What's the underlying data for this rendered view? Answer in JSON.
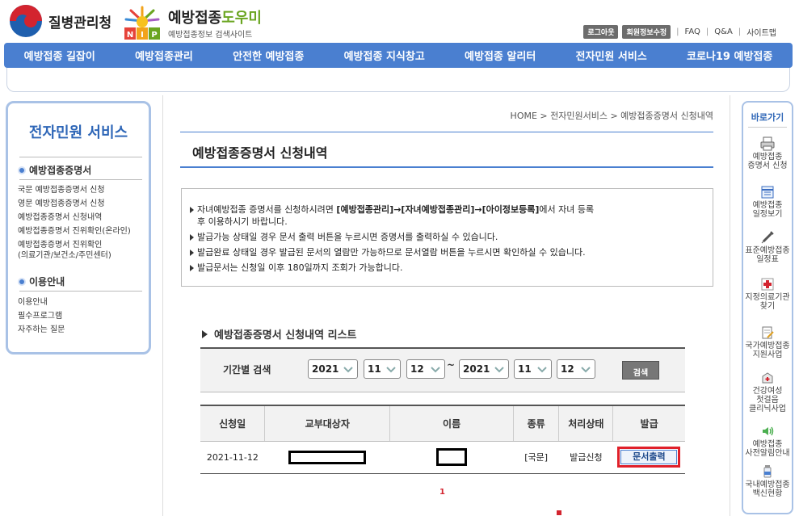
{
  "header": {
    "kdca_name": "질병관리청",
    "nip_title_a": "예방접종",
    "nip_title_b": "도우미",
    "nip_sub": "예방접종정보 검색사이트",
    "nip_mark": "NIP",
    "top_links": {
      "logout": "로그아웃",
      "member_edit": "회원정보수정",
      "faq": "FAQ",
      "qa": "Q&A",
      "sitemap": "사이트맵"
    }
  },
  "gnb": [
    "예방접종 길잡이",
    "예방접종관리",
    "안전한 예방접종",
    "예방접종 지식창고",
    "예방접종 알리터",
    "전자민원 서비스",
    "코로나19 예방접종"
  ],
  "sidebar": {
    "title": "전자민원 서비스",
    "section1": "예방접종증명서",
    "section1_items": [
      "국문 예방접종증명서 신청",
      "영문 예방접종증명서 신청",
      "예방접종증명서 신청내역",
      "예방접종증명서 진위확인(온라인)"
    ],
    "section1_item_multi_a": "예방접종증명서 진위확인",
    "section1_item_multi_b": "(의료기관/보건소/주민센터)",
    "section2": "이용안내",
    "section2_items": [
      "이용안내",
      "필수프로그램",
      "자주하는 질문"
    ]
  },
  "breadcrumb": "HOME > 전자민원서비스 > 예방접종증명서 신청내역",
  "page_title": "예방접종증명서 신청내역",
  "notice": {
    "line1_a": "자녀예방접종 증명서를 신청하시려면 ",
    "line1_b": "[예방접종관리]→[자녀예방접종관리]→[아이정보등록]",
    "line1_c": "에서 자녀 등록",
    "line1_d": "후 이용하시기 바랍니다.",
    "line2": "발급가능 상태일 경우 문서 출력 버튼을 누르시면 증명서를 출력하실 수 있습니다.",
    "line3": "발급완료 상태일 경우 발급된 문서의 열람만 가능하므로 문서열람 버튼을 누르시면 확인하실 수 있습니다.",
    "line4": "발급문서는 신청일 이후 180일까지 조회가 가능합니다."
  },
  "list_title": "예방접종증명서 신청내역 리스트",
  "search": {
    "label": "기간별 검색",
    "from_year": "2021",
    "from_month": "11",
    "from_day": "12",
    "tilde": "~",
    "to_year": "2021",
    "to_month": "11",
    "to_day": "12",
    "button": "검색"
  },
  "table": {
    "headers": [
      "신청일",
      "교부대상자",
      "이름",
      "종류",
      "처리상태",
      "발급"
    ],
    "rows": [
      {
        "date": "2021-11-12",
        "type": "[국문]",
        "status": "발급신청",
        "action": "문서출력"
      }
    ]
  },
  "pager": {
    "current": "1"
  },
  "quickbar": {
    "title": "바로가기",
    "items": [
      {
        "l1": "예방접종",
        "l2": "증명서 신청"
      },
      {
        "l1": "예방접종",
        "l2": "일정보기"
      },
      {
        "l1": "표준예방접종",
        "l2": "일정표"
      },
      {
        "l1": "지정의료기관",
        "l2": "찾기"
      },
      {
        "l1": "국가예방접종",
        "l2": "지원사업"
      },
      {
        "l1": "건강여성",
        "l2": "첫걸음",
        "l3": "클리닉사업"
      },
      {
        "l1": "예방접종",
        "l2": "사전알림안내"
      },
      {
        "l1": "국내예방접종",
        "l2": "백신현황"
      }
    ]
  },
  "colors": {
    "primary": "#4a7fd0",
    "accent_red": "#e0202a",
    "border_light": "#a9c2e6"
  }
}
